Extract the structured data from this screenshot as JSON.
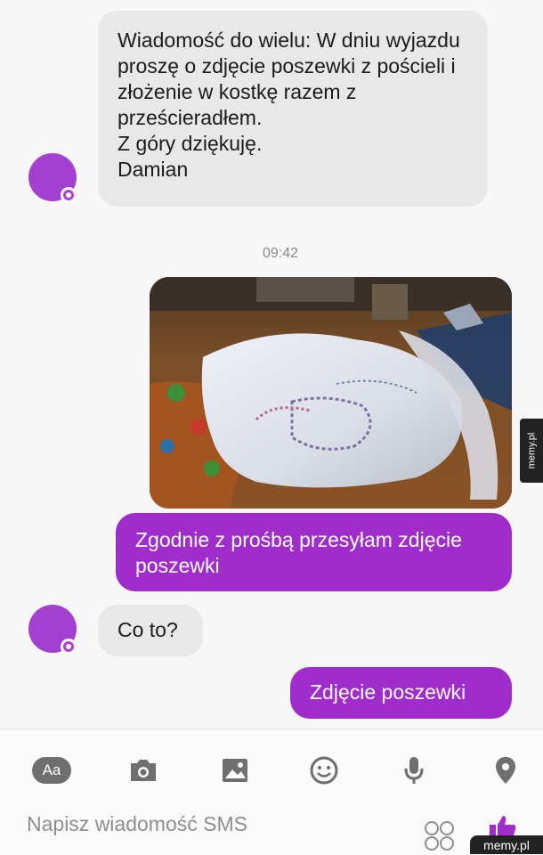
{
  "messages": {
    "m1": "Wiadomość do wielu: W dniu wyjazdu proszę o zdjęcie poszewki z pościeli i złożenie w kostkę razem z prześcieradłem.\nZ góry dziękuję.\nDamian",
    "timestamp": "09:42",
    "m2": "Zgodnie z prośbą przesyłam zdjęcie poszewki",
    "m3": "Co to?",
    "m4": "Zdjęcie poszewki"
  },
  "toolbar": {
    "text_button_label": "Aa",
    "icons": [
      "text-format-icon",
      "camera-icon",
      "gallery-icon",
      "emoji-icon",
      "microphone-icon",
      "location-pin-icon"
    ]
  },
  "compose": {
    "placeholder": "Napisz wiadomość SMS"
  },
  "watermark": "memy.pl",
  "colors": {
    "outgoing": "#a12ccc",
    "incoming": "#e8e8e8",
    "avatar": "#a33fd1"
  }
}
